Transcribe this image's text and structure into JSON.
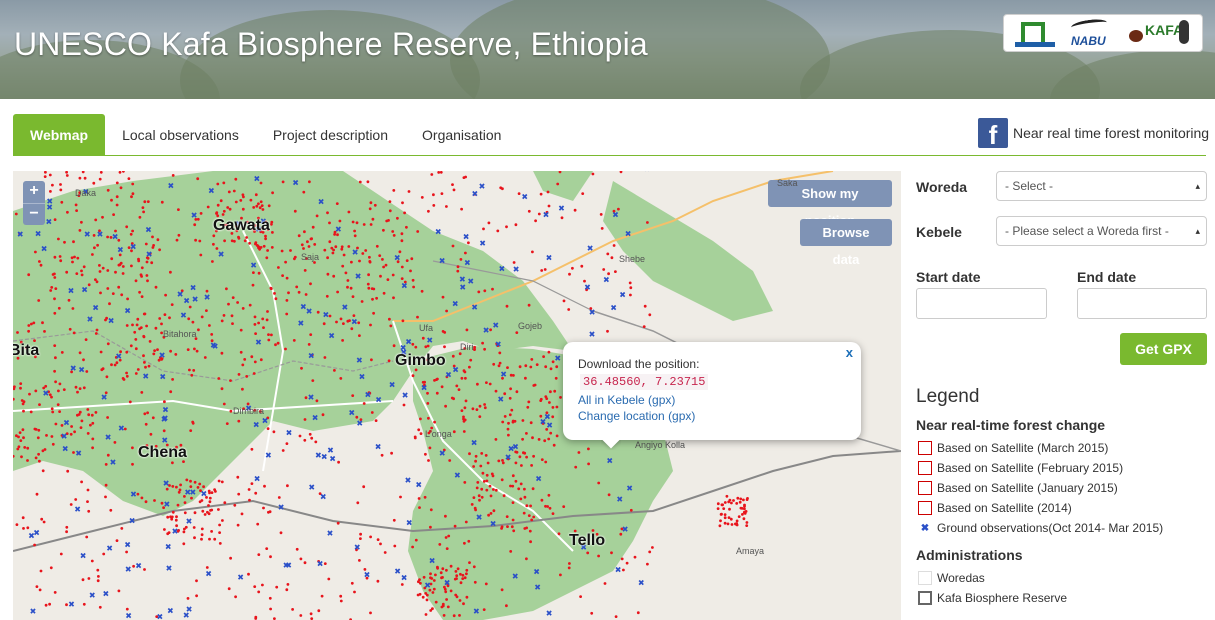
{
  "header": {
    "title": "UNESCO Kafa Biosphere Reserve, Ethiopia",
    "logos": {
      "nabu": "NABU",
      "kafa": "KAFA"
    }
  },
  "nav": {
    "tabs": [
      "Webmap",
      "Local observations",
      "Project description",
      "Organisation"
    ],
    "active": "Webmap",
    "facebook_icon": "f",
    "facebook_label": "Near real time forest monitoring"
  },
  "map": {
    "zoom_in": "+",
    "zoom_out": "−",
    "show_position_button": "Show my position",
    "browse_data_button": "Browse data",
    "cities": [
      "Gawata",
      "Gimbo",
      "Chena",
      "Tello",
      "Bita"
    ],
    "places": [
      "Daka",
      "Saja",
      "Bitahora",
      "Ufa",
      "Diri",
      "Gojeb",
      "Shebe",
      "Dimbira",
      "L'onga",
      "Angiyo Kolla",
      "Amaya",
      "Saka"
    ],
    "popup": {
      "title": "Download the position:",
      "coords": "36.48560, 7.23715",
      "link_kebele": "All in Kebele (gpx)",
      "link_change": "Change location (gpx)",
      "close": "x"
    }
  },
  "form": {
    "woreda_label": "Woreda",
    "woreda_value": "- Select -",
    "kebele_label": "Kebele",
    "kebele_value": "- Please select a Woreda first -",
    "start_label": "Start date",
    "end_label": "End date",
    "start_value": "",
    "end_value": "",
    "gpx_button": "Get GPX"
  },
  "legend": {
    "title": "Legend",
    "section1": "Near real-time forest change",
    "items": [
      "Based on Satellite (March 2015)",
      "Based on Satellite (February 2015)",
      "Based on Satellite (January 2015)",
      "Based on Satellite (2014)",
      "Ground observations(Oct 2014- Mar 2015)"
    ],
    "section2": "Administrations",
    "admin_items": [
      "Woredas",
      "Kafa Biosphere Reserve"
    ]
  },
  "colors": {
    "accent": "#7ab92f",
    "map_button": "#7f93b5",
    "forest": "#a6d19a",
    "change_points": "#e8141c",
    "ground_obs": "#2b50c8",
    "facebook": "#3b5998"
  }
}
